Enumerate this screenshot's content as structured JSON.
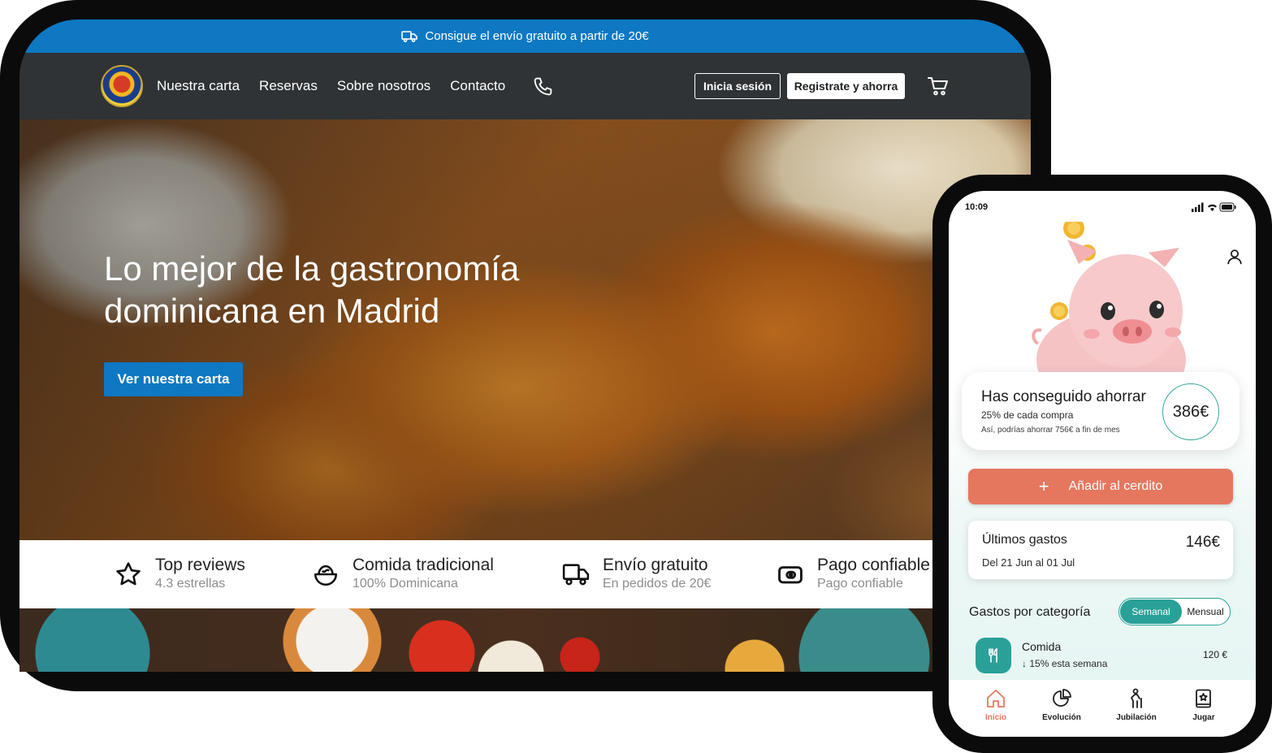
{
  "tablet": {
    "promo_text": "Consigue el envío gratuito a partir de 20€",
    "nav": {
      "links": [
        "Nuestra carta",
        "Reservas",
        "Sobre nosotros",
        "Contacto"
      ],
      "login_label": "Inicia sesión",
      "register_label": "Registrate y ahorra"
    },
    "hero": {
      "title": "Lo mejor de la gastronomía dominicana en Madrid",
      "cta_label": "Ver nuestra carta"
    },
    "features": [
      {
        "icon": "star-icon",
        "title": "Top reviews",
        "subtitle": "4.3 estrellas"
      },
      {
        "icon": "food-bowl-icon",
        "title": "Comida tradicional",
        "subtitle": "100% Dominicana"
      },
      {
        "icon": "truck-icon",
        "title": "Envío gratuito",
        "subtitle": "En pedidos de 20€"
      },
      {
        "icon": "wallet-icon",
        "title": "Pago confiable",
        "subtitle": "Pago confiable"
      }
    ]
  },
  "phone": {
    "time": "10:09",
    "savings": {
      "title": "Has conseguido ahorrar",
      "subtitle": "25% de cada compra",
      "note": "Así, podrías ahorrar 756€ a fin de mes",
      "amount": "386€"
    },
    "add_button_label": "Añadir al cerdito",
    "last_expenses": {
      "title": "Últimos gastos",
      "range": "Del 21 Jun al 01 Jul",
      "amount": "146€"
    },
    "category": {
      "label": "Gastos por categoría",
      "toggle_on": "Semanal",
      "toggle_off": "Mensual",
      "item": {
        "name": "Comida",
        "trend": "15% esta semana",
        "amount": "120 €"
      }
    },
    "tabs": [
      "Inicio",
      "Evolución",
      "Jubilación",
      "Jugar"
    ],
    "colors": {
      "accent": "#e5775f",
      "teal": "#2aa198",
      "brand_blue": "#0e78c3"
    }
  }
}
